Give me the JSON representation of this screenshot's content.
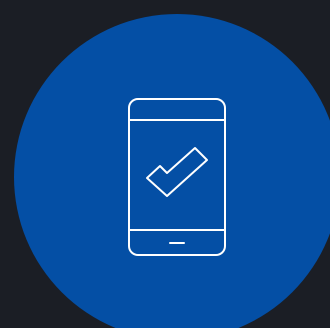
{
  "colors": {
    "background": "#1b1e25",
    "circle": "#044fa5",
    "icon_stroke": "#ffffff"
  },
  "icons": {
    "main": "smartphone-check-icon"
  }
}
